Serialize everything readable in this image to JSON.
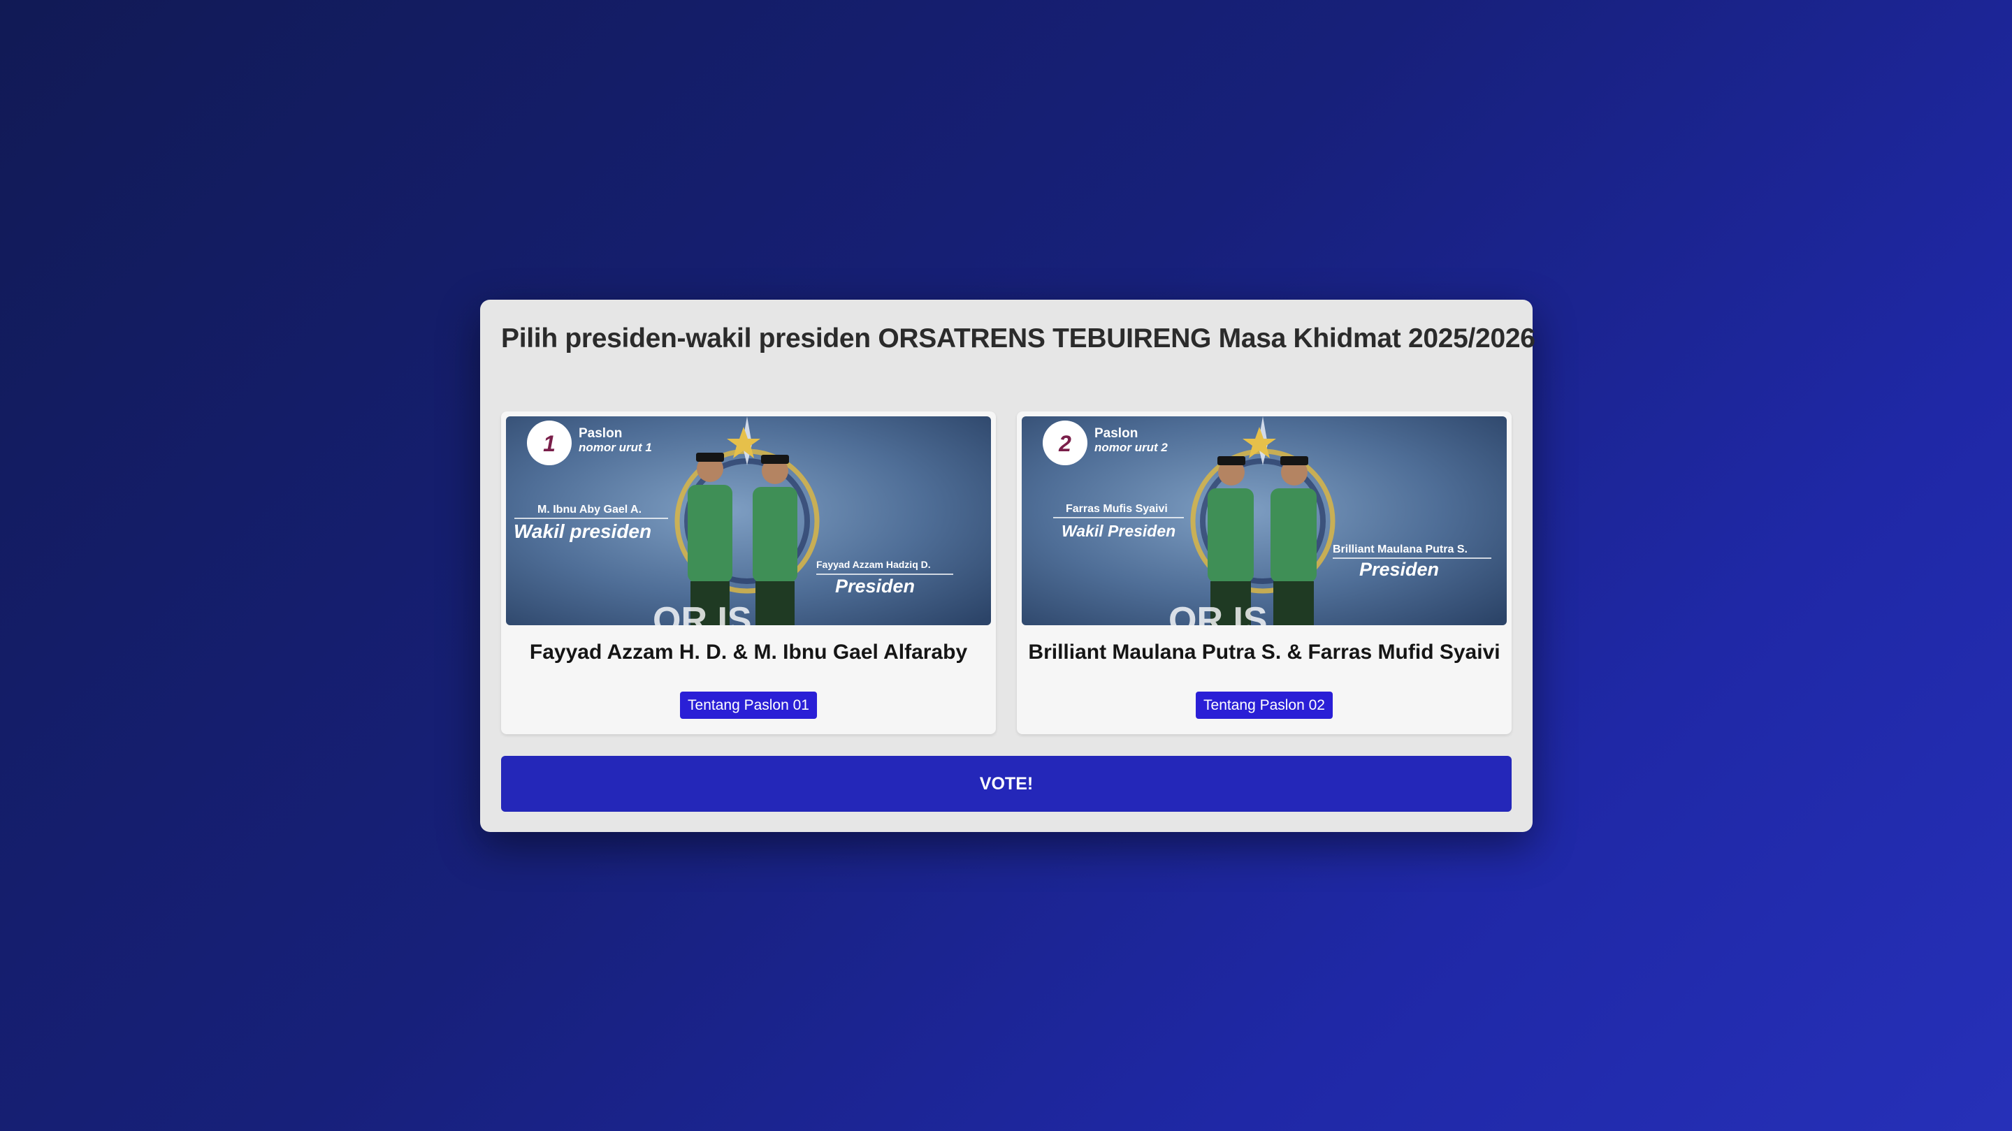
{
  "page": {
    "title": "Pilih presiden-wakil presiden ORSATRENS TEBUIRENG Masa Khidmat 2025/2026"
  },
  "candidates": [
    {
      "poster": {
        "number": "1",
        "paslon": "Paslon",
        "nomor_urut": "nomor urut 1",
        "wakil_name": "M. Ibnu Aby Gael A.",
        "wakil_role": "Wakil presiden",
        "presiden_name": "Fayyad Azzam Hadziq D.",
        "presiden_role": "Presiden",
        "logo_text": "OR  IS"
      },
      "name": "Fayyad Azzam H. D. & M. Ibnu Gael Alfaraby",
      "about_label": "Tentang Paslon 01"
    },
    {
      "poster": {
        "number": "2",
        "paslon": "Paslon",
        "nomor_urut": "nomor urut 2",
        "wakil_name": "Farras Mufis Syaivi",
        "wakil_role": "Wakil Presiden",
        "presiden_name": "Brilliant Maulana Putra S.",
        "presiden_role": "Presiden",
        "logo_text": "OR  IS"
      },
      "name": "Brilliant Maulana Putra S. & Farras Mufid Syaivi",
      "about_label": "Tentang Paslon 02"
    }
  ],
  "vote_label": "VOTE!",
  "colors": {
    "accent": "#2a1fd6",
    "vote": "#2427b9",
    "modal_bg": "#e6e6e6",
    "number_color": "#7a1f4a"
  }
}
